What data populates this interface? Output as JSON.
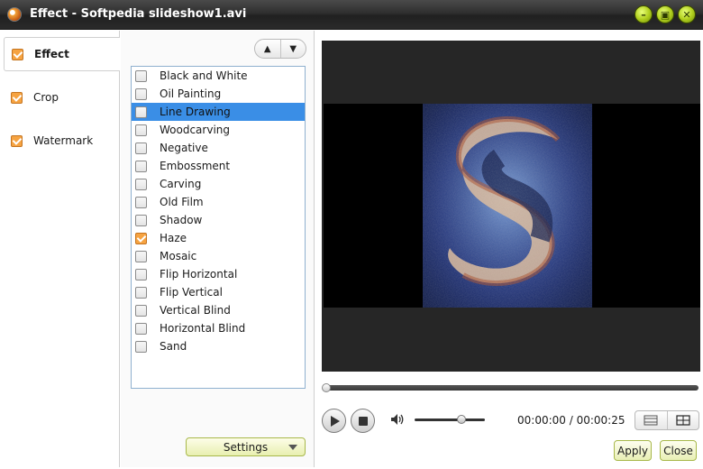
{
  "window": {
    "title": "Effect - Softpedia slideshow1.avi"
  },
  "nav": [
    {
      "label": "Effect",
      "checked": true,
      "active": true
    },
    {
      "label": "Crop",
      "checked": true,
      "active": false
    },
    {
      "label": "Watermark",
      "checked": true,
      "active": false
    }
  ],
  "effects": [
    {
      "label": "Black and White",
      "checked": false,
      "selected": false
    },
    {
      "label": "Oil Painting",
      "checked": false,
      "selected": false
    },
    {
      "label": "Line Drawing",
      "checked": false,
      "selected": true
    },
    {
      "label": "Woodcarving",
      "checked": false,
      "selected": false
    },
    {
      "label": "Negative",
      "checked": false,
      "selected": false
    },
    {
      "label": "Embossment",
      "checked": false,
      "selected": false
    },
    {
      "label": "Carving",
      "checked": false,
      "selected": false
    },
    {
      "label": "Old Film",
      "checked": false,
      "selected": false
    },
    {
      "label": "Shadow",
      "checked": false,
      "selected": false
    },
    {
      "label": "Haze",
      "checked": true,
      "selected": false
    },
    {
      "label": "Mosaic",
      "checked": false,
      "selected": false
    },
    {
      "label": "Flip Horizontal",
      "checked": false,
      "selected": false
    },
    {
      "label": "Flip Vertical",
      "checked": false,
      "selected": false
    },
    {
      "label": "Vertical Blind",
      "checked": false,
      "selected": false
    },
    {
      "label": "Horizontal Blind",
      "checked": false,
      "selected": false
    },
    {
      "label": "Sand",
      "checked": false,
      "selected": false
    }
  ],
  "settings_label": "Settings",
  "player": {
    "timecode": "00:00:00 / 00:00:25",
    "position": 0.0,
    "volume": 0.65
  },
  "buttons": {
    "apply": "Apply",
    "close": "Close"
  },
  "colors": {
    "accent_check": "#f6a341",
    "selection": "#3a8ee6",
    "window_button": "#b2d020"
  }
}
